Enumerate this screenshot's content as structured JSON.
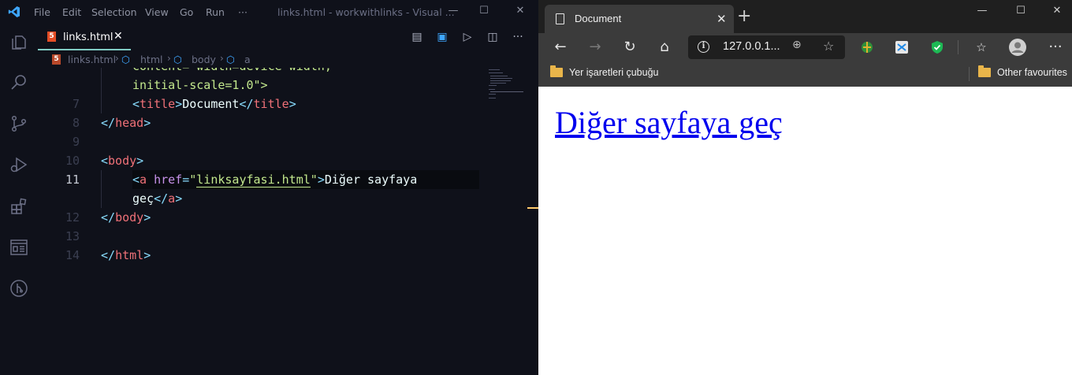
{
  "vscode": {
    "menu": [
      "File",
      "Edit",
      "Selection",
      "View",
      "Go",
      "Run",
      "···"
    ],
    "window_title": "links.html - workwithlinks - Visual ...",
    "tab": {
      "label": "links.html",
      "close": "✕",
      "icon_text": "5"
    },
    "breadcrumb": {
      "file": "links.html",
      "items": [
        "html",
        "body",
        "a"
      ]
    },
    "lines": [
      {
        "no": "",
        "text_attr": "content=\"width=device-width,",
        "faded": true
      },
      {
        "no": "",
        "text": "initial-scale=1.0\">"
      },
      {
        "no": "7",
        "tag": "title",
        "inner": "Document"
      },
      {
        "no": "8",
        "close_tag": "head"
      },
      {
        "no": "9"
      },
      {
        "no": "10",
        "open_tag": "body"
      },
      {
        "no": "11",
        "attr": "href",
        "value": "linksayfasi.html",
        "text": "Diğer sayfaya"
      },
      {
        "no": "",
        "text": "geç"
      },
      {
        "no": "12",
        "close_tag": "body"
      },
      {
        "no": "13"
      },
      {
        "no": "14",
        "close_tag": "html"
      }
    ]
  },
  "browser": {
    "tab_title": "Document",
    "tab_close": "✕",
    "new_tab": "+",
    "address": "127.0.0.1...",
    "favorites_bar": "Yer işaretleri çubuğu",
    "other_favourites": "Other favourites",
    "page_link_text": "Diğer sayfaya geç"
  },
  "colors": {
    "editor_bg": "#0f111a",
    "tag": "#f07178",
    "bracket": "#89ddff",
    "attr": "#c792ea",
    "string": "#c3e88d",
    "link": "#0000ee"
  }
}
